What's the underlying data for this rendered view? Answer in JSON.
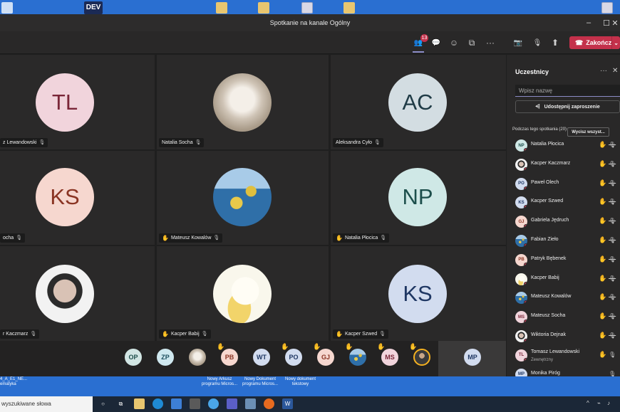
{
  "desktop": {
    "dev_label": "DEV",
    "bottom_labels": [
      {
        "text": "4_A_E1_NE...",
        "sub": "ematyka"
      },
      {
        "text": "Nowy Arkusz",
        "sub": "programu Micros..."
      },
      {
        "text": "Nowy Dokument",
        "sub": "programu Micros..."
      },
      {
        "text": "Nowy dokument",
        "sub": "tekstowy"
      }
    ]
  },
  "window": {
    "title": "Spotkanie na kanale Ogólny"
  },
  "toolbar": {
    "participants_badge": "13",
    "end_label": "Zakończ"
  },
  "icons": {
    "people": "👥",
    "chat": "💬",
    "reactions": "☺",
    "rooms": "⧉",
    "more": "···",
    "camera": "📷",
    "mic": "🎙",
    "share": "⬆",
    "phone": "☎",
    "chevron": "⌄",
    "hand": "✋",
    "mic_off": "🎙̸",
    "share_link": "⟨⟩"
  },
  "tiles": [
    {
      "initials": "TL",
      "name": "z Lewandowski",
      "hand": false,
      "bg": "#f1d4dc",
      "fg": "#7a2638"
    },
    {
      "initials": "",
      "name": "Natalia Socha",
      "hand": false,
      "bg": "#d7d2cc",
      "fg": "#333",
      "photo": "cat"
    },
    {
      "initials": "AC",
      "name": "Aleksandra Cyło",
      "hand": false,
      "bg": "#d3dde2",
      "fg": "#1f3b46"
    },
    {
      "initials": "KS",
      "name": "ocha",
      "hand": false,
      "bg": "#f6d7cf",
      "fg": "#8a3423"
    },
    {
      "initials": "",
      "name": "Mateusz Kowalów",
      "hand": true,
      "bg": "#6fa8d8",
      "fg": "#333",
      "photo": "sea"
    },
    {
      "initials": "NP",
      "name": "Natalia Płocica",
      "hand": true,
      "bg": "#cfe8e6",
      "fg": "#1d4f4c"
    },
    {
      "initials": "",
      "name": "r Kaczmarz",
      "hand": false,
      "bg": "#2a2a2a",
      "fg": "#fff",
      "photo": "face"
    },
    {
      "initials": "",
      "name": "Kacper Babij",
      "hand": true,
      "bg": "#f7f5e8",
      "fg": "#333",
      "photo": "duck"
    },
    {
      "initials": "KS",
      "name": "Kacper Szwed",
      "hand": true,
      "bg": "#d2dcef",
      "fg": "#1f3763"
    }
  ],
  "strip": [
    {
      "initials": "OP",
      "hand": false,
      "bg": "#d2e6e4",
      "fg": "#1d4f4c"
    },
    {
      "initials": "ZP",
      "hand": false,
      "bg": "#cfe8ef",
      "fg": "#1d4f5f"
    },
    {
      "initials": "",
      "hand": false,
      "bg": "#cbbfae",
      "fg": "#333",
      "photo": "cat"
    },
    {
      "initials": "PB",
      "hand": true,
      "bg": "#f6d7cf",
      "fg": "#8a3423"
    },
    {
      "initials": "WT",
      "hand": false,
      "bg": "#d2dcef",
      "fg": "#1f3763"
    },
    {
      "initials": "PO",
      "hand": true,
      "bg": "#d2dcef",
      "fg": "#1f3763"
    },
    {
      "initials": "GJ",
      "hand": true,
      "bg": "#f6d7cf",
      "fg": "#8a3423"
    },
    {
      "initials": "",
      "hand": true,
      "bg": "#6fa8d8",
      "fg": "#333",
      "photo": "sea"
    },
    {
      "initials": "MS",
      "hand": true,
      "bg": "#f1d4dc",
      "fg": "#7a2638"
    },
    {
      "initials": "",
      "hand": true,
      "bg": "#3a3a3a",
      "fg": "#fff",
      "photo": "self"
    },
    {
      "initials": "MP",
      "hand": false,
      "bg": "#d2dcef",
      "fg": "#1f3763"
    }
  ],
  "panel": {
    "title": "Uczestnicy",
    "search_placeholder": "Wpisz nazwę",
    "share_label": "Udostępnij zaproszenie",
    "section_label": "Podczas tego spotkania (20)",
    "mute_all_label": "Wycisz wszyst...",
    "participants": [
      {
        "initials": "NP",
        "name": "Natalia Płocica",
        "hand": true,
        "muted": true,
        "bg": "#cfe8e6",
        "fg": "#1d4f4c"
      },
      {
        "initials": "",
        "name": "Kacper Kaczmarz",
        "hand": true,
        "muted": true,
        "bg": "#2a2a2a",
        "fg": "#fff",
        "photo": "face"
      },
      {
        "initials": "PO",
        "name": "Paweł Olech",
        "hand": true,
        "muted": true,
        "bg": "#d2dcef",
        "fg": "#1f3763"
      },
      {
        "initials": "KS",
        "name": "Kacper Szwed",
        "hand": true,
        "muted": true,
        "bg": "#d2dcef",
        "fg": "#1f3763"
      },
      {
        "initials": "GJ",
        "name": "Gabriela Jędruch",
        "hand": true,
        "muted": true,
        "bg": "#f6d7cf",
        "fg": "#8a3423"
      },
      {
        "initials": "",
        "name": "Fabian Zieło",
        "hand": true,
        "muted": true,
        "bg": "#6fa8d8",
        "fg": "#333",
        "photo": "sea"
      },
      {
        "initials": "PB",
        "name": "Patryk Bębenek",
        "hand": true,
        "muted": true,
        "bg": "#f6d7cf",
        "fg": "#8a3423"
      },
      {
        "initials": "",
        "name": "Kacper Babij",
        "hand": true,
        "muted": true,
        "bg": "#f7f5e8",
        "fg": "#333",
        "photo": "duck"
      },
      {
        "initials": "",
        "name": "Mateusz Kowalów",
        "hand": true,
        "muted": true,
        "bg": "#6fa8d8",
        "fg": "#333",
        "photo": "sea"
      },
      {
        "initials": "MS",
        "name": "Mateusz Socha",
        "hand": true,
        "muted": true,
        "bg": "#f1d4dc",
        "fg": "#7a2638"
      },
      {
        "initials": "",
        "name": "Wiktoria Dejnak",
        "hand": true,
        "muted": true,
        "bg": "#c7a89a",
        "fg": "#333",
        "photo": "face"
      },
      {
        "initials": "TL",
        "name": "Tomasz Lewandowski",
        "sub": "Zewnętrzny",
        "hand": true,
        "muted": false,
        "bg": "#f1d4dc",
        "fg": "#7a2638"
      },
      {
        "initials": "MP",
        "name": "Monika Piróg",
        "hand": false,
        "muted": false,
        "bg": "#d2dcef",
        "fg": "#1f3763"
      }
    ]
  },
  "taskbar": {
    "search_text": "wyszukiwane słowa"
  }
}
